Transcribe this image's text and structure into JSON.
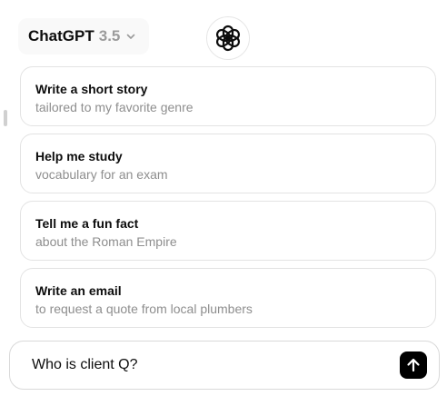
{
  "header": {
    "model_name": "ChatGPT",
    "model_version": "3.5",
    "dropdown_icon": "chevron-down-icon",
    "logo_icon": "openai-logo-icon"
  },
  "suggestions": [
    {
      "title": "Write a short story",
      "subtitle": "tailored to my favorite genre"
    },
    {
      "title": "Help me study",
      "subtitle": "vocabulary for an exam"
    },
    {
      "title": "Tell me a fun fact",
      "subtitle": "about the Roman Empire"
    },
    {
      "title": "Write an email",
      "subtitle": "to request a quote from local plumbers"
    }
  ],
  "composer": {
    "value": "Who is client Q?",
    "send_icon": "arrow-up-icon"
  },
  "colors": {
    "send_button": "#000000",
    "card_border": "#e3e3e3",
    "muted_text": "#8e8e8e"
  }
}
